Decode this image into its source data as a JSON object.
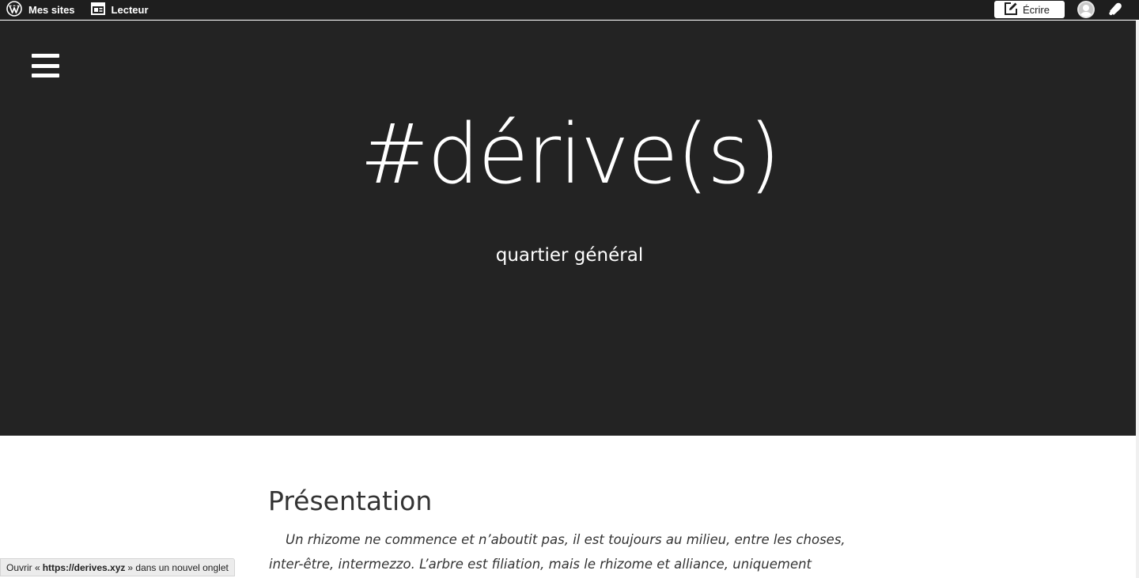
{
  "adminbar": {
    "my_sites": "Mes sites",
    "reader": "Lecteur",
    "write": "Écrire",
    "icons": [
      "wordpress-logo-icon",
      "reader-icon",
      "compose-icon",
      "avatar",
      "notifications-bell-icon"
    ]
  },
  "header": {
    "site_title": "#dérive(s)",
    "site_description": "quartier général",
    "background_color": "#232323"
  },
  "post": {
    "title": "Présentation",
    "excerpt": "Un rhizome ne commence et n’aboutit pas, il est toujours au milieu, entre les choses, inter-être, intermezzo. L’arbre est filiation, mais le rhizome et alliance, uniquement d’alliance. L’arbre impose"
  },
  "status_bar": {
    "prefix": "Ouvrir «",
    "url": "https://derives.xyz",
    "suffix": "» dans un nouvel onglet"
  }
}
